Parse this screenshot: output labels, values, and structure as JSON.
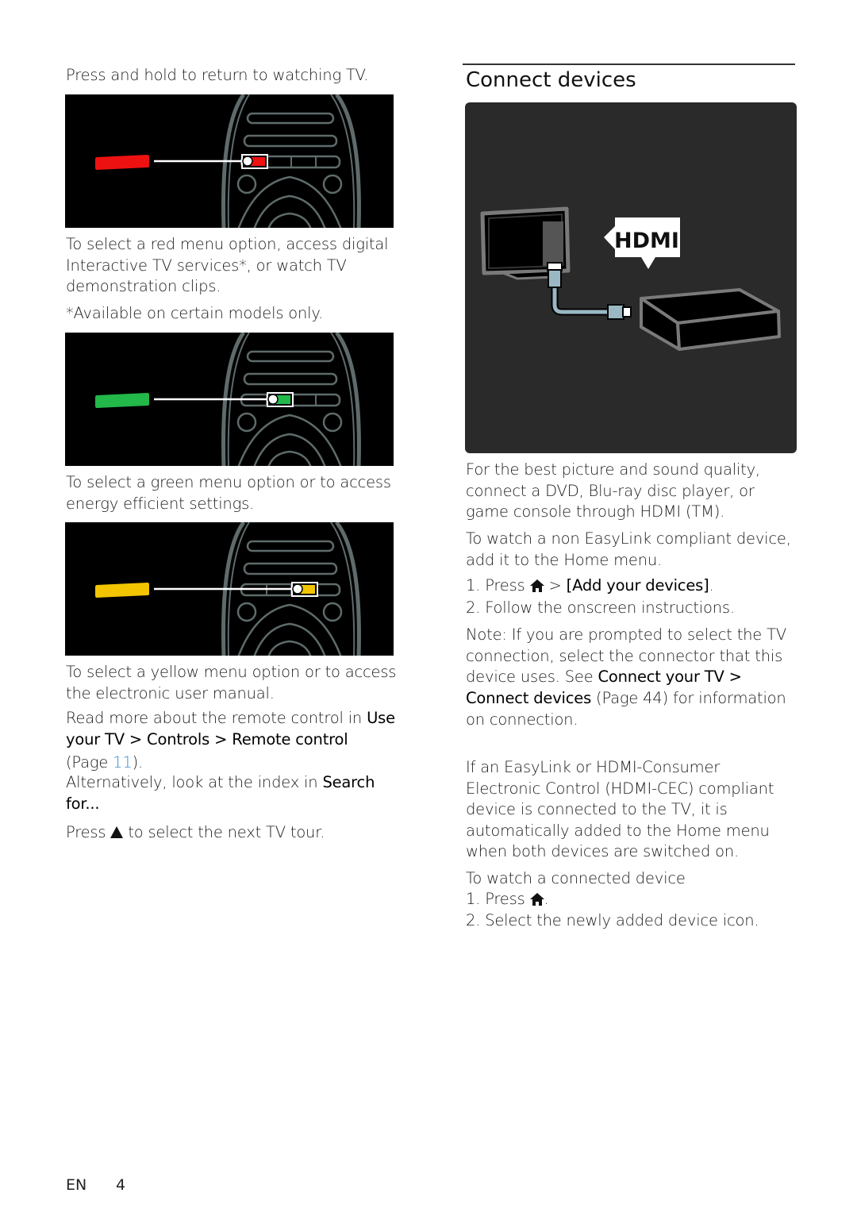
{
  "left": {
    "intro": "Press and hold to return to watching TV.",
    "red": {
      "description": "To select a red menu option, access digital Interactive TV services*, or watch TV demonstration clips.",
      "footnote": "*Available on certain models only.",
      "color": "#ee1111"
    },
    "green": {
      "description": "To select a green menu option or to access energy efficient settings.",
      "color": "#22b84a"
    },
    "yellow": {
      "description": "To select a yellow menu option or to access the electronic user manual.",
      "color": "#f2c500"
    },
    "read_more": {
      "prefix": "Read more about the remote control in ",
      "path_1": "Use your TV",
      "sep": " > ",
      "path_2": "Controls",
      "path_3": "Remote control",
      "page_prefix": "(Page ",
      "page_number": "11",
      "page_suffix": ").",
      "alt_prefix": "Alternatively, look at the index in ",
      "alt_link": "Search for...",
      "alt_link_1": "Search",
      "alt_link_2": "for..."
    },
    "next_tour": {
      "prefix": "Press ",
      "icon": "up-triangle-icon",
      "suffix": " to select the next TV tour."
    }
  },
  "right": {
    "heading": "Connect devices",
    "figure_label": "HDMI",
    "para1": "For the best picture and sound quality, connect a DVD, Blu-ray disc player, or game console through HDMI (TM).",
    "para2": "To watch a non EasyLink compliant device, add it to the Home menu.",
    "steps_a": {
      "step1_prefix": "1. Press ",
      "step1_icon": "home-icon",
      "step1_mid": " > ",
      "step1_link": "[Add your devices]",
      "step1_suffix": ".",
      "step2": "2. Follow the onscreen instructions."
    },
    "note": {
      "prefix": "Note: If you are prompted to select the TV connection, select the connector that this device uses. See ",
      "link_1": "Connect your TV >",
      "link_2": "Connect devices",
      "page": " (Page 44)",
      "suffix": " for information",
      "last_line": "on connection."
    },
    "para3": "If an EasyLink or HDMI-Consumer Electronic Control (HDMI-CEC) compliant device is connected to the TV, it is automatically added to the Home menu when both devices are switched on.",
    "steps_b": {
      "title": "To watch a connected device",
      "step1_prefix": "1. Press ",
      "step1_icon": "home-icon",
      "step1_suffix": ".",
      "step2": "2. Select the newly added device icon."
    }
  },
  "footer": {
    "language": "EN",
    "page_number": "4"
  }
}
